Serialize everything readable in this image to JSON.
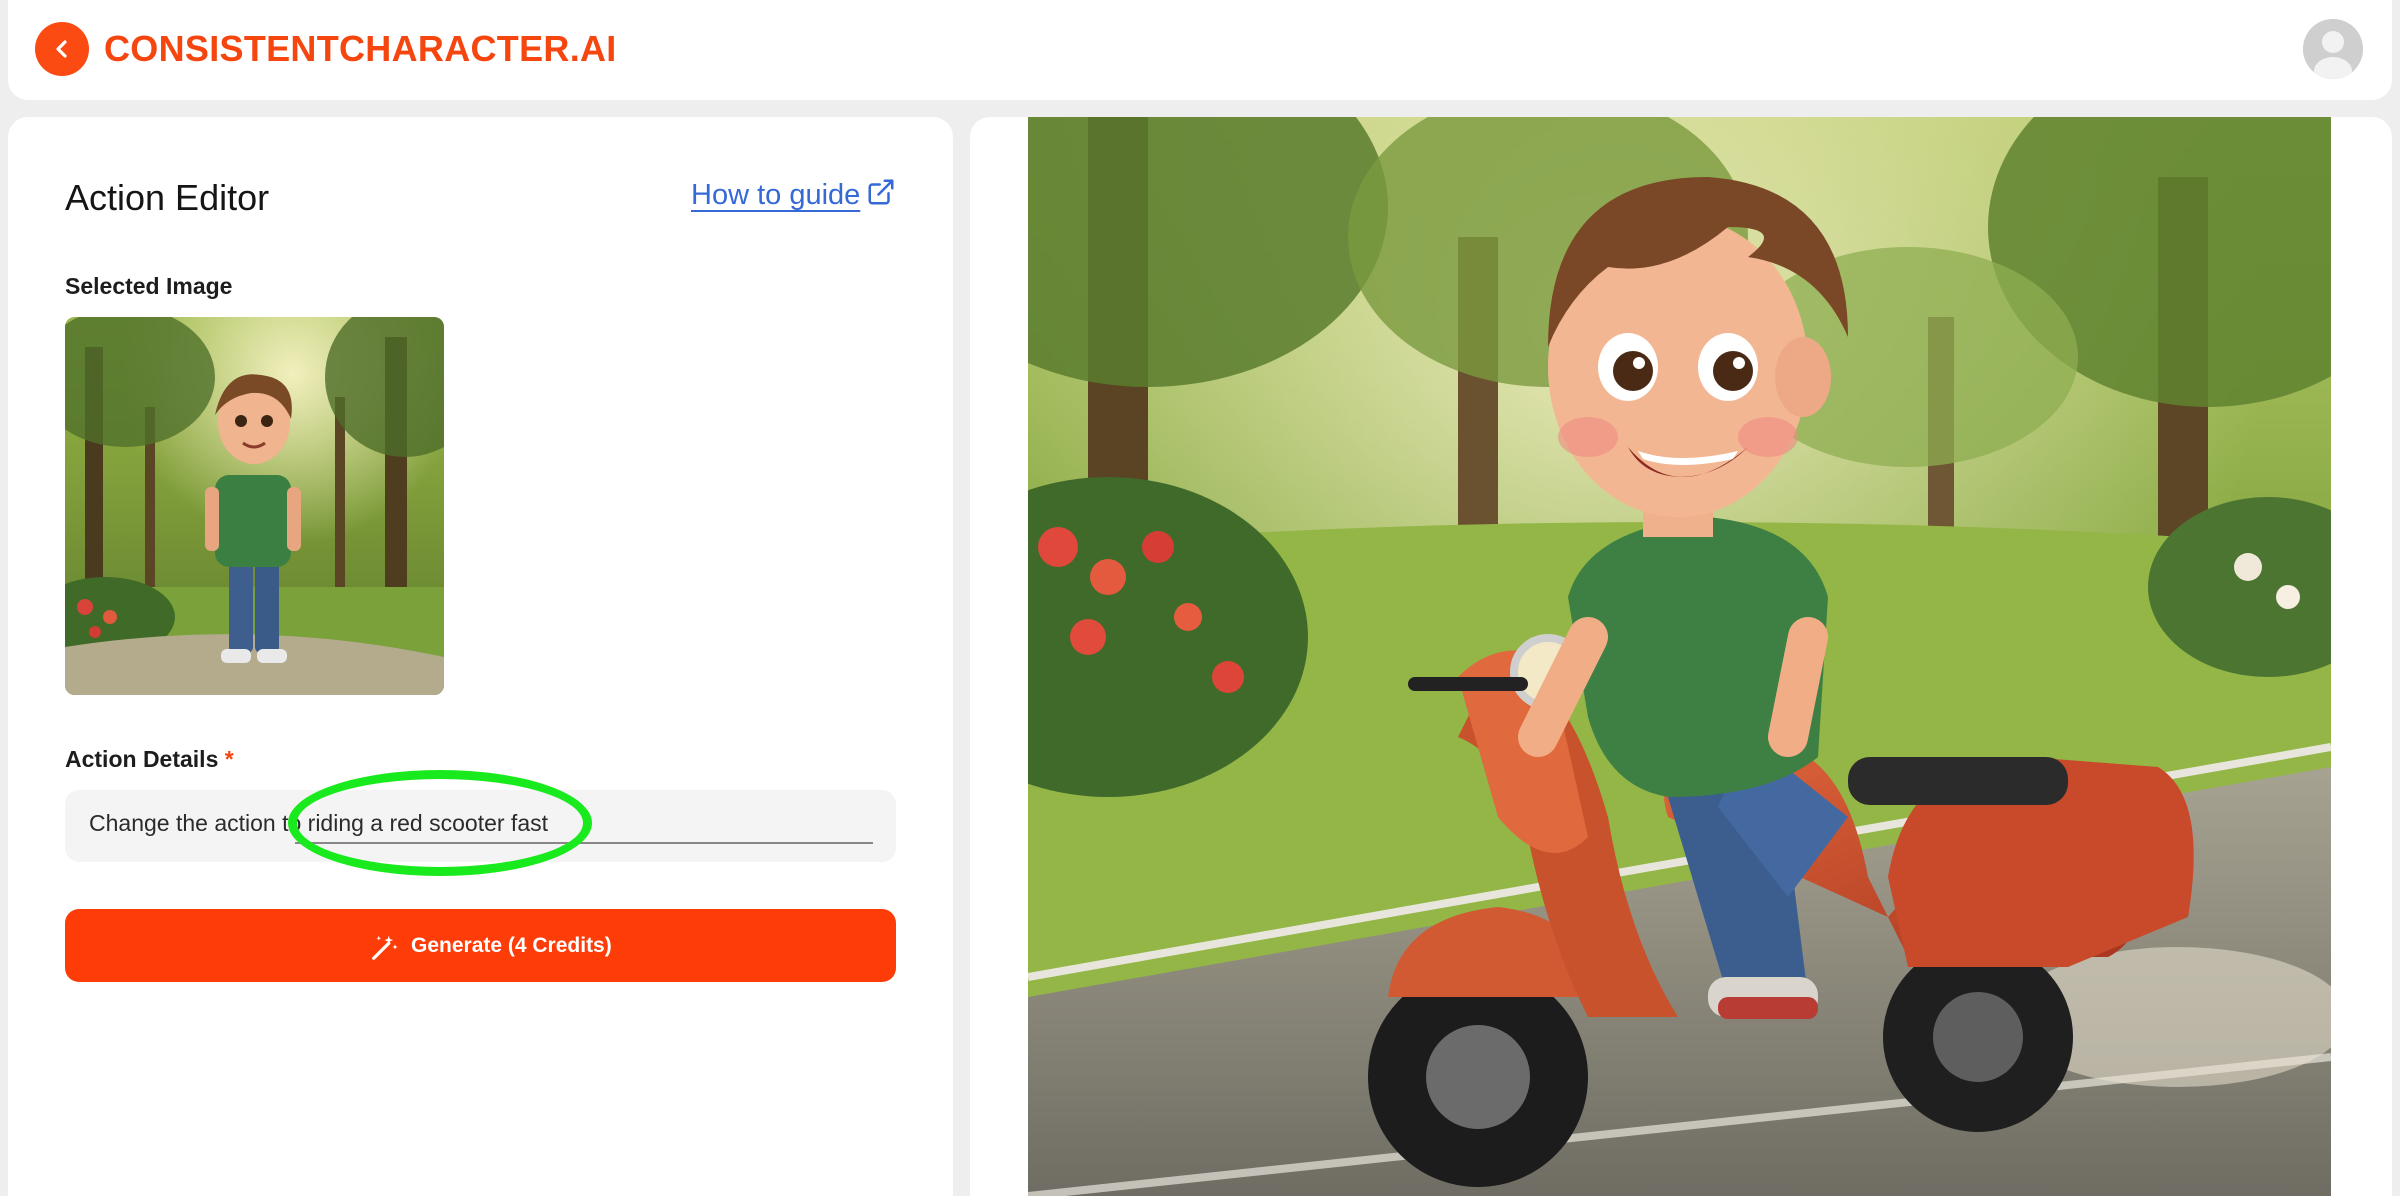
{
  "header": {
    "brand": "CONSISTENTCHARACTER.AI",
    "back_icon": "chevron-left-icon",
    "avatar_icon": "user-avatar-icon",
    "accent": "#f5460f"
  },
  "editor": {
    "title": "Action Editor",
    "guide_link": "How to guide",
    "guide_icon": "external-link-icon",
    "selected_image_label": "Selected Image",
    "action_label": "Action Details",
    "required_mark": "*",
    "action_value": "Change the action to riding a red scooter fast",
    "generate_label": "Generate (4 Credits)",
    "generate_icon": "magic-wand-icon",
    "button_color": "#fe3c08",
    "highlight_color": "#19ea1d"
  },
  "result": {
    "image": "generated-boy-scooter-image"
  }
}
